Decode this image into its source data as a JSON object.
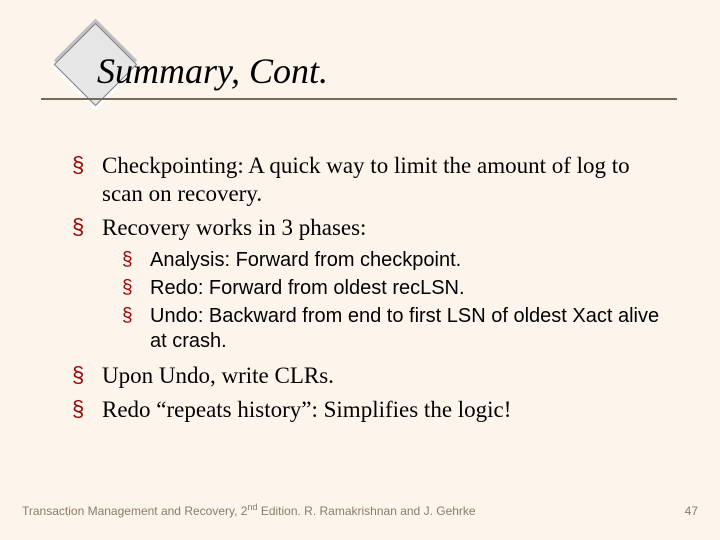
{
  "title": "Summary, Cont.",
  "bullets": [
    {
      "text": "Checkpointing:  A quick way to limit the amount of log to scan on recovery."
    },
    {
      "text": "Recovery works in 3 phases:",
      "sub": [
        "Analysis: Forward from checkpoint.",
        "Redo: Forward from oldest recLSN.",
        "Undo: Backward from end to first LSN of oldest Xact alive at crash."
      ]
    },
    {
      "text": "Upon Undo, write CLRs."
    },
    {
      "text": "Redo “repeats history”: Simplifies the logic!"
    }
  ],
  "footer": {
    "book": "Transaction Management and Recovery, ",
    "edition_num": "2",
    "edition_suffix": "nd",
    "edition_tail": " Edition. R. Ramakrishnan and J. Gehrke",
    "page": "47"
  }
}
